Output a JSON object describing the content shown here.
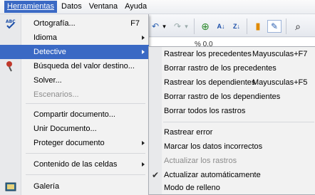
{
  "menubar": {
    "items": [
      "Herramientas",
      "Datos",
      "Ventana",
      "Ayuda"
    ]
  },
  "toolbar": {
    "glyphs": [
      "↶",
      "▾",
      "↷",
      "▾",
      "⊕",
      "A↓",
      "Z↓",
      "▮",
      "✎",
      "⌕"
    ]
  },
  "sheet": {
    "peek_text": "% 0.0"
  },
  "menu": {
    "items": [
      {
        "label": "Ortografía...",
        "shortcut": "F7",
        "icon": "spellcheck-icon"
      },
      {
        "label": "Idioma",
        "submenu": true
      },
      {
        "label": "Detective",
        "submenu": true,
        "highlighted": true
      },
      {
        "label": "Búsqueda del valor destino...",
        "icon": "goal-seek-icon"
      },
      {
        "label": "Solver..."
      },
      {
        "label": "Escenarios...",
        "disabled": true
      },
      {
        "label": "Compartir documento..."
      },
      {
        "label": "Unir Documento..."
      },
      {
        "label": "Proteger documento",
        "submenu": true
      },
      {
        "label": "Contenido de las celdas",
        "submenu": true
      },
      {
        "label": "Galería",
        "icon": "gallery-icon"
      }
    ]
  },
  "submenu": {
    "items": [
      {
        "label": "Rastrear los precedentes",
        "shortcut": "Mayusculas+F7"
      },
      {
        "label": "Borrar rastro de los precedentes"
      },
      {
        "label": "Rastrear los dependientes",
        "shortcut": "Mayusculas+F5"
      },
      {
        "label": "Borrar rastro de los dependientes"
      },
      {
        "label": "Borrar todos los rastros"
      },
      {
        "label": "Rastrear error"
      },
      {
        "label": "Marcar los datos incorrectos"
      },
      {
        "label": "Actualizar los rastros",
        "disabled": true
      },
      {
        "label": "Actualizar automáticamente",
        "checked": true
      },
      {
        "label": "Modo de relleno"
      }
    ]
  },
  "colors": {
    "highlight": "#3a69c4",
    "menu_bg": "#f2f2f2",
    "disabled_text": "#8c8c8c"
  }
}
